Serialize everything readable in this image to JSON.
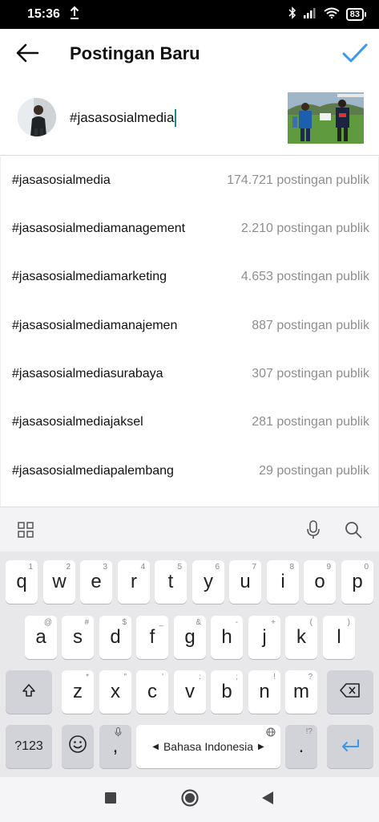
{
  "status_bar": {
    "time": "15:36",
    "battery": "83"
  },
  "header": {
    "title": "Postingan Baru"
  },
  "caption": {
    "value": "#jasasosialmedia"
  },
  "suggestions": [
    {
      "tag": "#jasasosialmedia",
      "count": "174.721 postingan publik"
    },
    {
      "tag": "#jasasosialmediamanagement",
      "count": "2.210 postingan publik"
    },
    {
      "tag": "#jasasosialmediamarketing",
      "count": "4.653 postingan publik"
    },
    {
      "tag": "#jasasosialmediamanajemen",
      "count": "887 postingan publik"
    },
    {
      "tag": "#jasasosialmediasurabaya",
      "count": "307 postingan publik"
    },
    {
      "tag": "#jasasosialmediajaksel",
      "count": "281 postingan publik"
    },
    {
      "tag": "#jasasosialmediapalembang",
      "count": "29 postingan publik"
    }
  ],
  "keyboard": {
    "row1": [
      {
        "key": "q",
        "hint": "1"
      },
      {
        "key": "w",
        "hint": "2"
      },
      {
        "key": "e",
        "hint": "3"
      },
      {
        "key": "r",
        "hint": "4"
      },
      {
        "key": "t",
        "hint": "5"
      },
      {
        "key": "y",
        "hint": "6"
      },
      {
        "key": "u",
        "hint": "7"
      },
      {
        "key": "i",
        "hint": "8"
      },
      {
        "key": "o",
        "hint": "9"
      },
      {
        "key": "p",
        "hint": "0"
      }
    ],
    "row2": [
      {
        "key": "a",
        "hint": "@"
      },
      {
        "key": "s",
        "hint": "#"
      },
      {
        "key": "d",
        "hint": "$"
      },
      {
        "key": "f",
        "hint": "_"
      },
      {
        "key": "g",
        "hint": "&"
      },
      {
        "key": "h",
        "hint": "-"
      },
      {
        "key": "j",
        "hint": "+"
      },
      {
        "key": "k",
        "hint": "("
      },
      {
        "key": "l",
        "hint": ")"
      }
    ],
    "row3": [
      {
        "key": "z",
        "hint": "*"
      },
      {
        "key": "x",
        "hint": "\""
      },
      {
        "key": "c",
        "hint": "'"
      },
      {
        "key": "v",
        "hint": ":"
      },
      {
        "key": "b",
        "hint": ";"
      },
      {
        "key": "n",
        "hint": "!"
      },
      {
        "key": "m",
        "hint": "?"
      }
    ],
    "symbols_label": "?123",
    "comma": ",",
    "space_label": "Bahasa Indonesia",
    "period": ".",
    "period_hint": "!?"
  },
  "colors": {
    "accent": "#3897f0",
    "caret": "#1a8a8a",
    "muted": "#8e8e8e"
  },
  "icons": {
    "back": "arrow-left-icon",
    "confirm": "check-icon",
    "grid": "grid-icon",
    "mic": "microphone-icon",
    "search": "search-icon",
    "shift": "shift-icon",
    "backspace": "backspace-icon",
    "emoji": "emoji-icon",
    "enter": "enter-icon",
    "globe": "globe-icon"
  }
}
